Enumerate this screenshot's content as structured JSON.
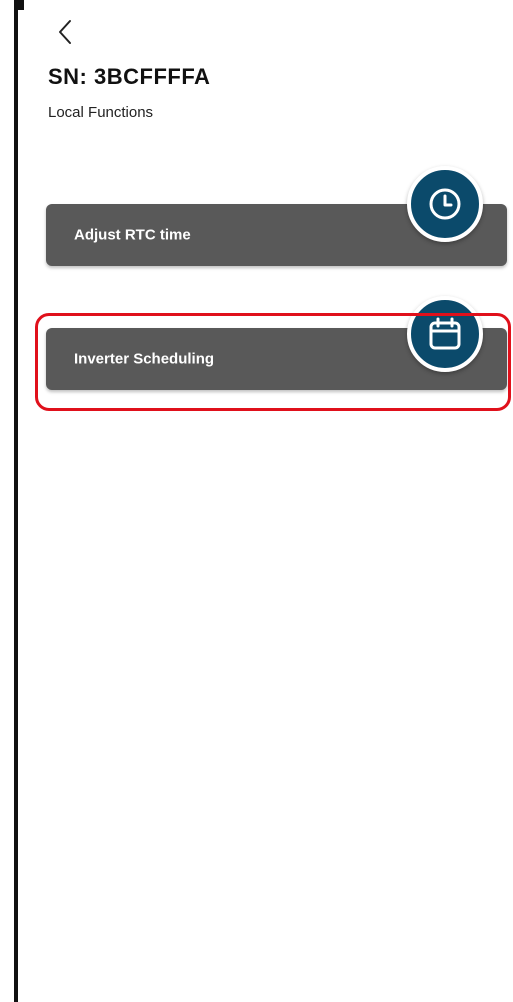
{
  "header": {
    "serial": "SN: 3BCFFFFA",
    "subtitle": "Local Functions"
  },
  "functions": [
    {
      "label": "Adjust RTC time",
      "icon": "clock-icon"
    },
    {
      "label": "Inverter Scheduling",
      "icon": "calendar-icon"
    }
  ],
  "colors": {
    "button_bg": "#595959",
    "icon_circle": "#0b4a6b",
    "highlight": "#e0101b"
  }
}
